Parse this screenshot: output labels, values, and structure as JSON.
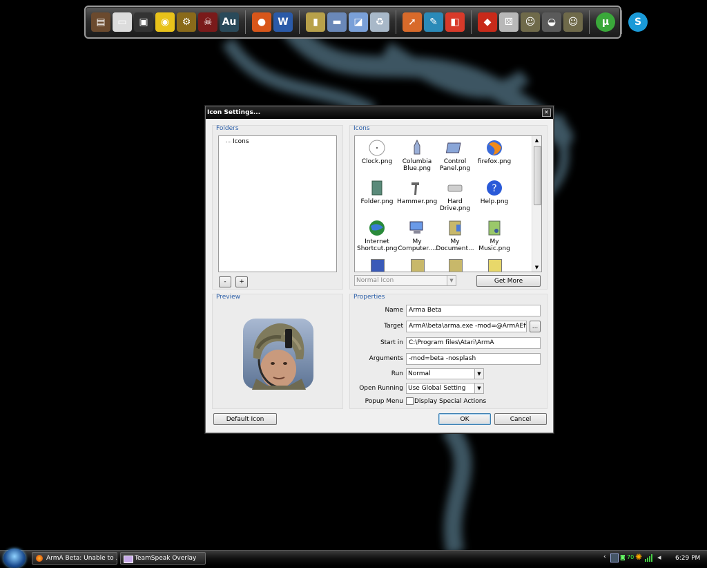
{
  "dock": {
    "icons": [
      "desktop-icon",
      "terminal-icon",
      "media-icon",
      "fruity-icon",
      "settings-gear-icon",
      "pirate-icon",
      "audition-icon",
      "firefox-icon",
      "word-icon",
      "folder-icon",
      "computer-icon",
      "control-panel-icon",
      "recycle-bin-icon",
      "share-icon",
      "pen-icon",
      "paint-icon",
      "game-icon",
      "dice-icon",
      "soldier-icon",
      "helmet-icon",
      "soldier-icon-2",
      "utorrent-icon",
      "skype-icon"
    ]
  },
  "dialog": {
    "title": "Icon Settings...",
    "folders": {
      "title": "Folders",
      "tree_item": "Icons",
      "minus_label": "-",
      "plus_label": "+"
    },
    "icons": {
      "title": "Icons",
      "items": [
        {
          "label": "Clock.png"
        },
        {
          "label": "Columbia Blue.png"
        },
        {
          "label": "Control Panel.png"
        },
        {
          "label": "firefox.png"
        },
        {
          "label": "Folder.png"
        },
        {
          "label": "Hammer.png"
        },
        {
          "label": "Hard Drive.png"
        },
        {
          "label": "Help.png"
        },
        {
          "label": "Internet Shortcut.png"
        },
        {
          "label": "My Computer...."
        },
        {
          "label": "My Document..."
        },
        {
          "label": "My Music.png"
        }
      ],
      "type_select": "Normal Icon",
      "get_more_label": "Get More"
    },
    "preview": {
      "title": "Preview"
    },
    "properties": {
      "title": "Properties",
      "name_label": "Name",
      "name_value": "Arma Beta",
      "target_label": "Target",
      "target_value": "ArmA\\beta\\arma.exe -mod=@ArmAEffects",
      "browse_label": "...",
      "startin_label": "Start in",
      "startin_value": "C:\\Program files\\Atari\\ArmA",
      "arguments_label": "Arguments",
      "arguments_value": "-mod=beta -nosplash",
      "run_label": "Run",
      "run_value": "Normal",
      "open_running_label": "Open Running",
      "open_running_value": "Use Global Setting",
      "popup_menu_label": "Popup Menu",
      "popup_menu_checkbox": "Display Special Actions"
    },
    "buttons": {
      "default_icon": "Default Icon",
      "ok": "OK",
      "cancel": "Cancel"
    }
  },
  "taskbar": {
    "tasks": [
      {
        "label": "ArmA Beta: Unable to ..."
      },
      {
        "label": "TeamSpeak Overlay"
      }
    ],
    "tray_temp": "70",
    "clock": "6:29 PM"
  }
}
